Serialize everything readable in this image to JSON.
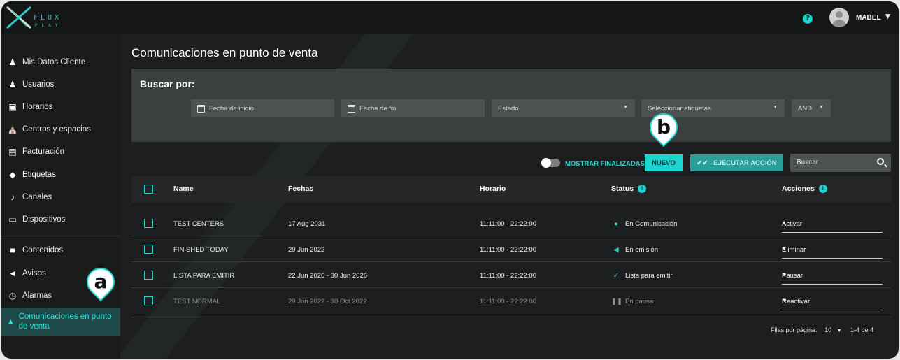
{
  "app": {
    "logo_word": "FLUX",
    "logo_sub": "PLAY"
  },
  "header": {
    "help_icon": "?",
    "user_name": "MABEL"
  },
  "sidebar": {
    "items": [
      {
        "label": "Mis Datos Cliente",
        "icon": "person-icon"
      },
      {
        "label": "Usuarios",
        "icon": "users-icon"
      },
      {
        "label": "Horarios",
        "icon": "calendar-icon"
      },
      {
        "label": "Centros y espacios",
        "icon": "building-icon"
      },
      {
        "label": "Facturación",
        "icon": "card-icon"
      },
      {
        "label": "Etiquetas",
        "icon": "tag-icon"
      },
      {
        "label": "Canales",
        "icon": "music-icon"
      },
      {
        "label": "Dispositivos",
        "icon": "devices-icon"
      },
      {
        "label": "Contenidos",
        "icon": "folder-icon"
      },
      {
        "label": "Avisos",
        "icon": "megaphone-icon"
      },
      {
        "label": "Alarmas",
        "icon": "alarm-icon"
      },
      {
        "label": "Comunicaciones en punto de venta",
        "icon": "speaker-icon"
      }
    ]
  },
  "main": {
    "title": "Comunicaciones en punto de venta",
    "search": {
      "title": "Buscar por:",
      "start_date": "Fecha de inicio",
      "end_date": "Fecha de fin",
      "status": "Estado",
      "tags": "Seleccionar etiquetas",
      "logic": "AND"
    },
    "toolbar": {
      "toggle_label": "MOSTRAR FINALIZADAS",
      "new_label": "NUEVO",
      "execute_label": "EJECUTAR ACCIÓN",
      "search_placeholder": "Buscar"
    },
    "table": {
      "headers": [
        "Name",
        "Fechas",
        "Horario",
        "Status",
        "Acciones"
      ],
      "rows": [
        {
          "name": "TEST CENTERS",
          "dates": "17 Aug 2031",
          "time": "11:11:00 - 22:22:00",
          "status": "En Comunicación",
          "action": "Activar"
        },
        {
          "name": "FINISHED TODAY",
          "dates": "29 Jun 2022",
          "time": "11:11:00 - 22:22:00",
          "status": "En emisión",
          "action": "Eliminar"
        },
        {
          "name": "LISTA PARA EMITIR",
          "dates": "22 Jun 2026 - 30 Jun 2026",
          "time": "11:11:00 - 22:22:00",
          "status": "Lista para emitir",
          "action": "Pausar"
        },
        {
          "name": "TEST NORMAL",
          "dates": "29 Jun 2022 - 30 Oct 2022",
          "time": "11:11:00 - 22:22:00",
          "status": "En pausa",
          "action": "Reactivar"
        }
      ]
    },
    "pagination": {
      "label": "Filas por página:",
      "per_page": "10",
      "range": "1-4 de 4"
    }
  },
  "callouts": {
    "a": "a",
    "b": "b"
  },
  "colors": {
    "accent": "#1fd5cf",
    "background": "#1d1e1f",
    "panel": "#3b3f40"
  }
}
